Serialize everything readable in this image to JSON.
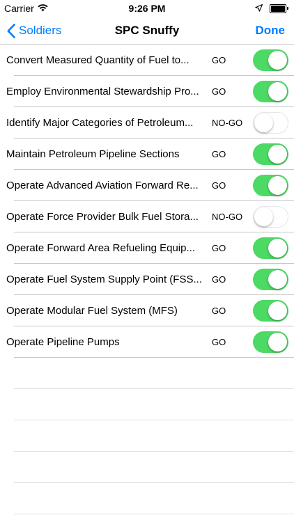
{
  "status_bar": {
    "carrier": "Carrier",
    "time": "9:26 PM",
    "battery_level": 1.0
  },
  "nav": {
    "back_label": "Soldiers",
    "title": "SPC Snuffy",
    "done_label": "Done"
  },
  "colors": {
    "tint": "#007aff",
    "switch_on": "#4cd964",
    "separator": "#c8c7cc"
  },
  "tasks": [
    {
      "label": "Convert Measured Quantity of Fuel to...",
      "status": "GO",
      "on": true
    },
    {
      "label": "Employ Environmental Stewardship Pro...",
      "status": "GO",
      "on": true
    },
    {
      "label": "Identify Major Categories of Petroleum...",
      "status": "NO-GO",
      "on": false
    },
    {
      "label": "Maintain Petroleum Pipeline Sections",
      "status": "GO",
      "on": true
    },
    {
      "label": "Operate Advanced Aviation Forward Re...",
      "status": "GO",
      "on": true
    },
    {
      "label": "Operate Force Provider Bulk Fuel Stora...",
      "status": "NO-GO",
      "on": false
    },
    {
      "label": "Operate Forward Area Refueling Equip...",
      "status": "GO",
      "on": true
    },
    {
      "label": "Operate Fuel System Supply Point (FSS...",
      "status": "GO",
      "on": true
    },
    {
      "label": "Operate Modular Fuel System (MFS)",
      "status": "GO",
      "on": true
    },
    {
      "label": "Operate Pipeline Pumps",
      "status": "GO",
      "on": true
    }
  ]
}
